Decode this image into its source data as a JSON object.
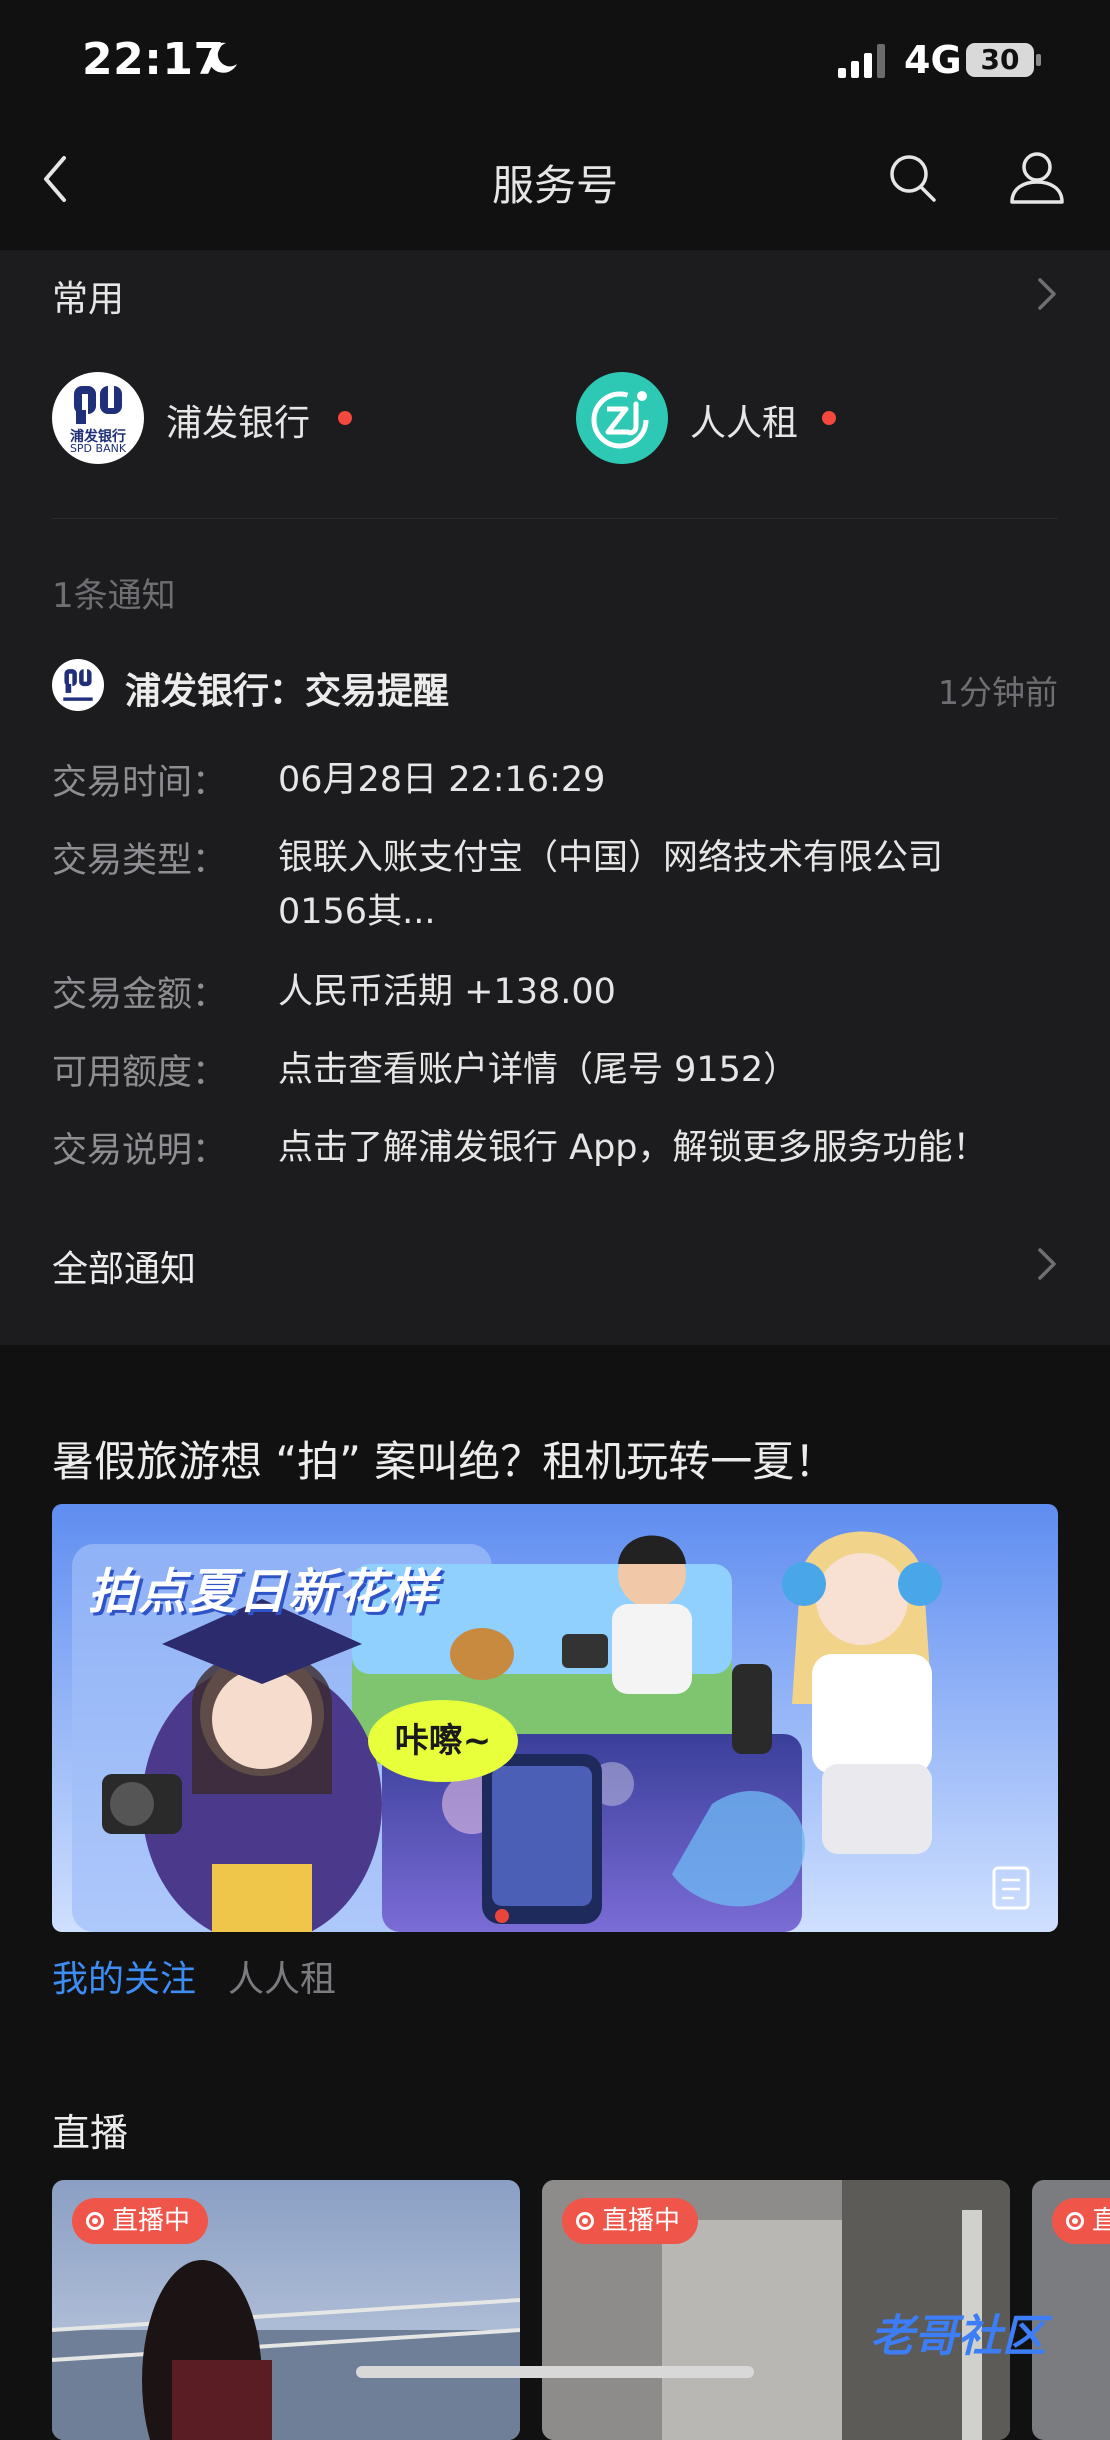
{
  "status_bar": {
    "time": "22:17",
    "network": "4G",
    "battery": "30"
  },
  "nav": {
    "title": "服务号"
  },
  "favorites": {
    "label": "常用",
    "items": [
      {
        "name": "浦发银行",
        "logo_text": "浦发银行",
        "logo_sub": "SPD BANK",
        "badge": "unread-dot"
      },
      {
        "name": "人人租",
        "badge": "unread-dot"
      }
    ]
  },
  "notifications": {
    "count_label": "1条通知",
    "message": {
      "sender_title": "浦发银行：交易提醒",
      "time": "1分钟前",
      "rows": [
        {
          "label": "交易时间：",
          "value": "06月28日  22:16:29"
        },
        {
          "label": "交易类型：",
          "value": "银联入账支付宝（中国）网络技术有限公司 0156其..."
        },
        {
          "label": "交易金额：",
          "value": "人民币活期 +138.00"
        },
        {
          "label": "可用额度：",
          "value": "点击查看账户详情（尾号 9152）"
        },
        {
          "label": "交易说明：",
          "value": "点击了解浦发银行 App，解锁更多服务功能！"
        }
      ]
    },
    "all_label": "全部通知"
  },
  "article": {
    "title": "暑假旅游想 “拍” 案叫绝？租机玩转一夏！",
    "banner_headline": "拍点夏日新花样",
    "banner_sticker": "咔嚓~",
    "follow_label": "我的关注",
    "source_name": "人人租"
  },
  "live": {
    "title": "直播",
    "badge": "直播中",
    "badge_partial": "直"
  },
  "watermark": "老哥社区",
  "colors": {
    "accent_blue": "#3d8df5",
    "live_red": "#f0554a",
    "card_bg": "#1c1c1e",
    "page_bg": "#111111"
  }
}
